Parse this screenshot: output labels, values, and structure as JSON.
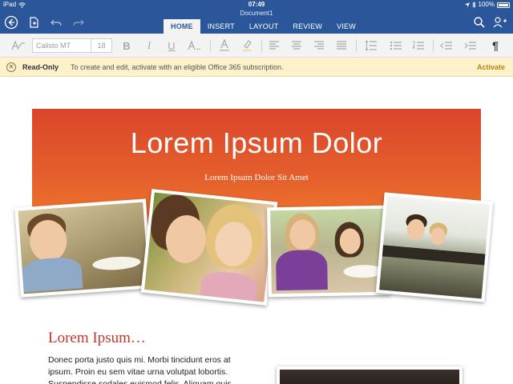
{
  "status_bar": {
    "device": "iPad",
    "time": "07:49",
    "battery": "100%"
  },
  "ribbon": {
    "document_title": "Document1",
    "tabs": [
      {
        "label": "HOME",
        "active": true
      },
      {
        "label": "INSERT",
        "active": false
      },
      {
        "label": "LAYOUT",
        "active": false
      },
      {
        "label": "REVIEW",
        "active": false
      },
      {
        "label": "VIEW",
        "active": false
      }
    ]
  },
  "toolbar": {
    "font_name": "Calisto MT",
    "font_size": "18",
    "bold": "B",
    "italic": "I",
    "underline": "U",
    "font_color": "A"
  },
  "notice": {
    "label": "Read-Only",
    "message": "To create and edit, activate with an eligible Office 365 subscription.",
    "action": "Activate"
  },
  "document": {
    "banner_title": "Lorem Ipsum Dolor",
    "banner_subtitle": "Lorem Ipsum Dolor Sit Amet",
    "section_title": "Lorem Ipsum…",
    "body_text": "Donec porta justo quis mi. Morbi tincidunt eros at ipsum. Proin eu sem vitae urna volutpat lobortis. Suspendisse sodales euismod felis. Aliquam quis"
  },
  "colors": {
    "ribbon_blue": "#2b579a",
    "banner_orange": "#e5612c",
    "notice_bg": "#fdf1cb",
    "section_red": "#c0392b"
  }
}
